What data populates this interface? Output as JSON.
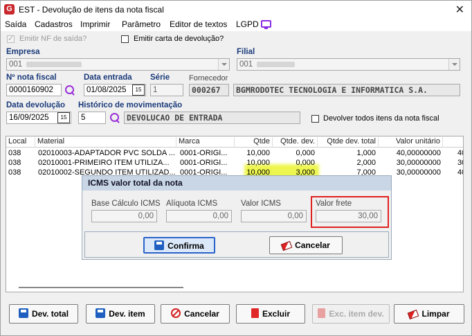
{
  "window": {
    "title": "EST - Devolução de itens da nota fiscal",
    "close": "✕",
    "logo_letter": "G"
  },
  "menu": [
    "Saída",
    "Cadastros",
    "Imprimir",
    "Parâmetro",
    "Editor de textos",
    "LGPD"
  ],
  "options": {
    "emitir_nf": {
      "label": "Emitir NF de saída?",
      "checked": true,
      "enabled": false
    },
    "emitir_carta": {
      "label": "Emitir carta de devolução?",
      "checked": false
    },
    "devolver_todos": {
      "label": "Devolver todos itens da nota fiscal",
      "checked": false
    }
  },
  "empresa": {
    "label": "Empresa",
    "value": "001"
  },
  "filial": {
    "label": "Filial",
    "value": "001"
  },
  "nota": {
    "label": "Nº nota fiscal",
    "value": "0000160902"
  },
  "data_entrada": {
    "label": "Data entrada",
    "value": "01/08/2025"
  },
  "serie": {
    "label": "Série",
    "value": "1"
  },
  "fornecedor": {
    "label": "Fornecedor",
    "code": "000267",
    "name": "BGMRODOTEC TECNOLOGIA E INFORMATICA S.A."
  },
  "data_devolucao": {
    "label": "Data devolução",
    "value": "16/09/2025"
  },
  "historico": {
    "label": "Histórico de movimentação",
    "code": "5",
    "description": "DEVOLUCAO DE ENTRADA"
  },
  "calendar_glyph": "15",
  "grid": {
    "columns": [
      "Local",
      "Material",
      "Marca",
      "Qtde",
      "Qtde. dev.",
      "Qtde dev. total",
      "Valor unitário"
    ],
    "rows": [
      [
        "038",
        "02010003-ADAPTADOR PVC SOLDA ...",
        "0001-ORIGI...",
        "10,000",
        "0,000",
        "1,000",
        "40,00000000",
        "40"
      ],
      [
        "038",
        "02010001-PRIMEIRO ITEM UTILIZA...",
        "0001-ORIGI...",
        "10,000",
        "0,000",
        "2,000",
        "30,00000000",
        "30"
      ],
      [
        "038",
        "02010002-SEGUNDO ITEM UTILIZAD...",
        "0001-ORIGI...",
        "10,000",
        "3,000",
        "7,000",
        "30,00000000",
        "40"
      ]
    ]
  },
  "dialog": {
    "title": "ICMS valor total da nota",
    "fields": [
      {
        "label": "Base Cálculo ICMS",
        "value": "0,00"
      },
      {
        "label": "Alíquota ICMS",
        "value": "0,00"
      },
      {
        "label": "Valor ICMS",
        "value": "0,00"
      },
      {
        "label": "Valor frete",
        "value": "30,00"
      }
    ],
    "confirm": "Confirma",
    "cancel": "Cancelar"
  },
  "buttons": {
    "dev_total": "Dev. total",
    "dev_item": "Dev. item",
    "cancelar": "Cancelar",
    "excluir": "Excluir",
    "exc_item": "Exc. item dev.",
    "limpar": "Limpar"
  },
  "colors": {
    "header_label": "#1a3a7a",
    "accent": "#2a63c8",
    "danger": "#e02020",
    "search": "#9b30d9",
    "highlight": "#ebf531"
  }
}
